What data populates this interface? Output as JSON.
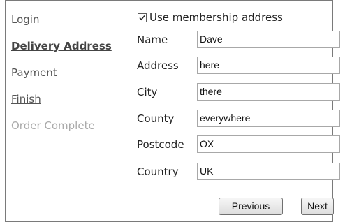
{
  "nav": {
    "items": [
      {
        "label": "Login"
      },
      {
        "label": "Delivery Address"
      },
      {
        "label": "Payment"
      },
      {
        "label": "Finish"
      },
      {
        "label": "Order Complete"
      }
    ]
  },
  "membership": {
    "label": "Use membership address",
    "checked": true
  },
  "form": {
    "fields": [
      {
        "label": "Name",
        "value": "Dave"
      },
      {
        "label": "Address",
        "value": "here"
      },
      {
        "label": "City",
        "value": "there"
      },
      {
        "label": "County",
        "value": "everywhere"
      },
      {
        "label": "Postcode",
        "value": "OX"
      },
      {
        "label": "Country",
        "value": "UK"
      }
    ]
  },
  "buttons": {
    "previous": "Previous",
    "next": "Next"
  }
}
